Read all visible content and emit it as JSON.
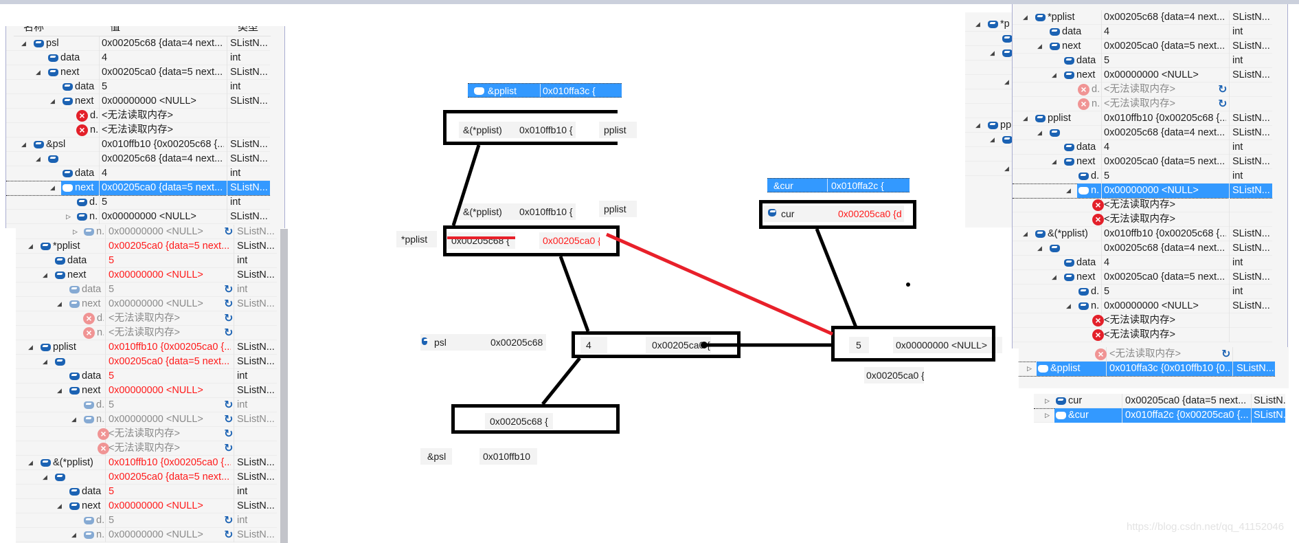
{
  "colors": {
    "selection": "#3399ff",
    "changed_value": "#ff1a1a",
    "icon_blue": "#1b62b3",
    "error_red": "#e3202a",
    "pointer_line_new": "#e8202a"
  },
  "panels": {
    "watch_top_left": {
      "header": {
        "name": "名称",
        "value": "值",
        "type": "类型"
      },
      "rows": [
        {
          "level": 0,
          "expander": "expanded",
          "icon": "field-icon",
          "name": "psl",
          "value": "0x00205c68 {data=4 next...",
          "type": "SListN...",
          "state": "normal"
        },
        {
          "level": 1,
          "expander": "none",
          "icon": "field-icon",
          "name": "data",
          "value": "4",
          "type": "int",
          "state": "normal"
        },
        {
          "level": 1,
          "expander": "expanded",
          "icon": "field-icon",
          "name": "next",
          "value": "0x00205ca0 {data=5 next...",
          "type": "SListN...",
          "state": "normal"
        },
        {
          "level": 2,
          "expander": "none",
          "icon": "field-icon",
          "name": "data",
          "value": "5",
          "type": "int",
          "state": "normal"
        },
        {
          "level": 2,
          "expander": "expanded",
          "icon": "field-icon",
          "name": "next",
          "value": "0x00000000 <NULL>",
          "type": "SListN...",
          "state": "normal"
        },
        {
          "level": 3,
          "expander": "none",
          "icon": "error-icon",
          "name": "d..",
          "value": "<无法读取内存>",
          "type": "",
          "state": "normal"
        },
        {
          "level": 3,
          "expander": "none",
          "icon": "error-icon",
          "name": "n..",
          "value": "<无法读取内存>",
          "type": "",
          "state": "normal"
        },
        {
          "level": 0,
          "expander": "expanded",
          "icon": "field-icon",
          "name": "&psl",
          "value": "0x010ffb10 {0x00205c68 {...",
          "type": "SListN...",
          "state": "normal"
        },
        {
          "level": 1,
          "expander": "expanded",
          "icon": "field-icon",
          "name": "",
          "value": "0x00205c68 {data=4 next...",
          "type": "SListN...",
          "state": "normal"
        },
        {
          "level": 2,
          "expander": "none",
          "icon": "field-icon",
          "name": "data",
          "value": "4",
          "type": "int",
          "state": "normal"
        },
        {
          "level": 2,
          "expander": "expanded",
          "icon": "field-icon",
          "name": "next",
          "value": "0x00205ca0 {data=5 next...",
          "type": "SListN...",
          "state": "selected"
        },
        {
          "level": 3,
          "expander": "none",
          "icon": "field-icon",
          "name": "d..",
          "value": "5",
          "type": "int",
          "state": "normal"
        },
        {
          "level": 3,
          "expander": "collapsed",
          "icon": "field-icon",
          "name": "n..",
          "value": "0x00000000 <NULL>",
          "type": "SListN...",
          "state": "normal"
        }
      ]
    },
    "watch_bottom_left": {
      "rows": [
        {
          "level": 3,
          "expander": "collapsed",
          "icon": "field-icon",
          "name": "n..",
          "value": "0x00000000 <NULL>",
          "type": "SListN...",
          "state": "stale",
          "refresh": true
        },
        {
          "level": 0,
          "expander": "expanded",
          "icon": "field-icon",
          "name": "*pplist",
          "value": "0x00205ca0 {data=5 next...",
          "type": "SListN...",
          "state": "changed"
        },
        {
          "level": 1,
          "expander": "none",
          "icon": "field-icon",
          "name": "data",
          "value": "5",
          "type": "int",
          "state": "changed"
        },
        {
          "level": 1,
          "expander": "expanded",
          "icon": "field-icon",
          "name": "next",
          "value": "0x00000000 <NULL>",
          "type": "SListN...",
          "state": "changed"
        },
        {
          "level": 2,
          "expander": "none",
          "icon": "field-icon",
          "name": "data",
          "value": "5",
          "type": "int",
          "state": "stale",
          "refresh": true
        },
        {
          "level": 2,
          "expander": "expanded",
          "icon": "field-icon",
          "name": "next",
          "value": "0x00000000 <NULL>",
          "type": "SListN...",
          "state": "stale",
          "refresh": true
        },
        {
          "level": 3,
          "expander": "none",
          "icon": "error-icon",
          "name": "d..",
          "value": "<无法读取内存>",
          "type": "",
          "state": "stale",
          "refresh": true
        },
        {
          "level": 3,
          "expander": "none",
          "icon": "error-icon",
          "name": "n..",
          "value": "<无法读取内存>",
          "type": "",
          "state": "stale",
          "refresh": true
        },
        {
          "level": 0,
          "expander": "expanded",
          "icon": "field-icon",
          "name": "pplist",
          "value": "0x010ffb10 {0x00205ca0 {...",
          "type": "SListN...",
          "state": "changed"
        },
        {
          "level": 1,
          "expander": "expanded",
          "icon": "field-icon",
          "name": "",
          "value": "0x00205ca0 {data=5 next...",
          "type": "SListN...",
          "state": "changed"
        },
        {
          "level": 2,
          "expander": "none",
          "icon": "field-icon",
          "name": "data",
          "value": "5",
          "type": "int",
          "state": "changed"
        },
        {
          "level": 2,
          "expander": "expanded",
          "icon": "field-icon",
          "name": "next",
          "value": "0x00000000 <NULL>",
          "type": "SListN...",
          "state": "changed"
        },
        {
          "level": 3,
          "expander": "none",
          "icon": "field-icon",
          "name": "d..",
          "value": "5",
          "type": "int",
          "state": "stale",
          "refresh": true
        },
        {
          "level": 3,
          "expander": "expanded",
          "icon": "field-icon",
          "name": "n..",
          "value": "0x00000000 <NULL>",
          "type": "SListN...",
          "state": "stale",
          "refresh": true
        },
        {
          "level": 4,
          "expander": "none",
          "icon": "error-icon",
          "name": "",
          "value": "<无法读取内存>",
          "type": "",
          "state": "stale",
          "refresh": true
        },
        {
          "level": 4,
          "expander": "none",
          "icon": "error-icon",
          "name": "",
          "value": "<无法读取内存>",
          "type": "",
          "state": "stale",
          "refresh": true
        },
        {
          "level": 0,
          "expander": "expanded",
          "icon": "field-icon",
          "name": "&(*pplist)",
          "value": "0x010ffb10 {0x00205ca0 {...",
          "type": "SListN...",
          "state": "changed"
        },
        {
          "level": 1,
          "expander": "expanded",
          "icon": "field-icon",
          "name": "",
          "value": "0x00205ca0 {data=5 next...",
          "type": "SListN...",
          "state": "changed"
        },
        {
          "level": 2,
          "expander": "none",
          "icon": "field-icon",
          "name": "data",
          "value": "5",
          "type": "int",
          "state": "changed"
        },
        {
          "level": 2,
          "expander": "expanded",
          "icon": "field-icon",
          "name": "next",
          "value": "0x00000000 <NULL>",
          "type": "SListN...",
          "state": "changed"
        },
        {
          "level": 3,
          "expander": "none",
          "icon": "field-icon",
          "name": "d..",
          "value": "5",
          "type": "int",
          "state": "stale",
          "refresh": true
        },
        {
          "level": 3,
          "expander": "expanded",
          "icon": "field-icon",
          "name": "n..",
          "value": "0x00000000 <NULL>",
          "type": "SListN...",
          "state": "stale",
          "refresh": true
        }
      ]
    },
    "watch_behind_right": {
      "rows": [
        {
          "level": 0,
          "expander": "expanded",
          "icon": "field-icon",
          "name": "*p",
          "value": "",
          "type": "",
          "state": "normal"
        },
        {
          "level": 1,
          "expander": "none",
          "icon": "field-icon",
          "name": "",
          "value": "",
          "type": "",
          "state": "normal"
        },
        {
          "level": 1,
          "expander": "expanded",
          "icon": "field-icon",
          "name": "",
          "value": "",
          "type": "",
          "state": "normal"
        },
        {
          "level": 0,
          "expander": "none",
          "icon": "none",
          "name": "",
          "value": "",
          "type": "",
          "state": "normal"
        },
        {
          "level": 2,
          "expander": "expanded",
          "icon": "none",
          "name": "",
          "value": "",
          "type": "",
          "state": "normal"
        },
        {
          "level": 0,
          "expander": "none",
          "icon": "none",
          "name": "",
          "value": "",
          "type": "",
          "state": "normal"
        },
        {
          "level": 0,
          "expander": "none",
          "icon": "none",
          "name": "",
          "value": "",
          "type": "",
          "state": "normal"
        },
        {
          "level": 0,
          "expander": "expanded",
          "icon": "field-icon",
          "name": "pp",
          "value": "",
          "type": "",
          "state": "normal"
        },
        {
          "level": 1,
          "expander": "expanded",
          "icon": "field-icon",
          "name": "",
          "value": "",
          "type": "",
          "state": "normal"
        },
        {
          "level": 0,
          "expander": "none",
          "icon": "none",
          "name": "",
          "value": "",
          "type": "",
          "state": "normal"
        },
        {
          "level": 2,
          "expander": "expanded",
          "icon": "none",
          "name": "",
          "value": "",
          "type": "",
          "state": "normal"
        }
      ]
    },
    "watch_top_right": {
      "rows": [
        {
          "level": 0,
          "expander": "expanded",
          "icon": "field-icon",
          "name": "*pplist",
          "value": "0x00205c68 {data=4 next...",
          "type": "SListN...",
          "state": "normal"
        },
        {
          "level": 1,
          "expander": "none",
          "icon": "field-icon",
          "name": "data",
          "value": "4",
          "type": "int",
          "state": "normal"
        },
        {
          "level": 1,
          "expander": "expanded",
          "icon": "field-icon",
          "name": "next",
          "value": "0x00205ca0 {data=5 next...",
          "type": "SListN...",
          "state": "normal"
        },
        {
          "level": 2,
          "expander": "none",
          "icon": "field-icon",
          "name": "data",
          "value": "5",
          "type": "int",
          "state": "normal"
        },
        {
          "level": 2,
          "expander": "expanded",
          "icon": "field-icon",
          "name": "next",
          "value": "0x00000000 <NULL>",
          "type": "SListN...",
          "state": "normal"
        },
        {
          "level": 3,
          "expander": "none",
          "icon": "error-icon",
          "name": "d..",
          "value": "<无法读取内存>",
          "type": "",
          "state": "stale",
          "refresh": true
        },
        {
          "level": 3,
          "expander": "none",
          "icon": "error-icon",
          "name": "n..",
          "value": "<无法读取内存>",
          "type": "",
          "state": "stale",
          "refresh": true
        },
        {
          "level": 0,
          "expander": "expanded",
          "icon": "field-icon",
          "name": "pplist",
          "value": "0x010ffb10 {0x00205c68 {...",
          "type": "SListN...",
          "state": "normal"
        },
        {
          "level": 1,
          "expander": "expanded",
          "icon": "field-icon",
          "name": "",
          "value": "0x00205c68 {data=4 next...",
          "type": "SListN...",
          "state": "normal"
        },
        {
          "level": 2,
          "expander": "none",
          "icon": "field-icon",
          "name": "data",
          "value": "4",
          "type": "int",
          "state": "normal"
        },
        {
          "level": 2,
          "expander": "expanded",
          "icon": "field-icon",
          "name": "next",
          "value": "0x00205ca0 {data=5 next...",
          "type": "SListN...",
          "state": "normal"
        },
        {
          "level": 3,
          "expander": "none",
          "icon": "field-icon",
          "name": "d..",
          "value": "5",
          "type": "int",
          "state": "normal"
        },
        {
          "level": 3,
          "expander": "expanded",
          "icon": "field-icon",
          "name": "n..",
          "value": "0x00000000 <NULL>",
          "type": "SListN...",
          "state": "selected"
        },
        {
          "level": 4,
          "expander": "none",
          "icon": "error-icon",
          "name": "",
          "value": "<无法读取内存>",
          "type": "",
          "state": "normal"
        },
        {
          "level": 4,
          "expander": "none",
          "icon": "error-icon",
          "name": "",
          "value": "<无法读取内存>",
          "type": "",
          "state": "normal"
        },
        {
          "level": 0,
          "expander": "expanded",
          "icon": "field-icon",
          "name": "&(*pplist)",
          "value": "0x010ffb10 {0x00205c68 {...",
          "type": "SListN...",
          "state": "normal"
        },
        {
          "level": 1,
          "expander": "expanded",
          "icon": "field-icon",
          "name": "",
          "value": "0x00205c68 {data=4 next...",
          "type": "SListN...",
          "state": "normal"
        },
        {
          "level": 2,
          "expander": "none",
          "icon": "field-icon",
          "name": "data",
          "value": "4",
          "type": "int",
          "state": "normal"
        },
        {
          "level": 2,
          "expander": "expanded",
          "icon": "field-icon",
          "name": "next",
          "value": "0x00205ca0 {data=5 next...",
          "type": "SListN...",
          "state": "normal"
        },
        {
          "level": 3,
          "expander": "none",
          "icon": "field-icon",
          "name": "d..",
          "value": "5",
          "type": "int",
          "state": "normal"
        },
        {
          "level": 3,
          "expander": "expanded",
          "icon": "field-icon",
          "name": "n..",
          "value": "0x00000000 <NULL>",
          "type": "SListN...",
          "state": "normal"
        },
        {
          "level": 4,
          "expander": "none",
          "icon": "error-icon",
          "name": "",
          "value": "<无法读取内存>",
          "type": "",
          "state": "normal"
        },
        {
          "level": 4,
          "expander": "none",
          "icon": "error-icon",
          "name": "",
          "value": "<无法读取内存>",
          "type": "",
          "state": "normal"
        }
      ]
    },
    "watch_pplist": {
      "rows": [
        {
          "level": 4,
          "expander": "none",
          "icon": "error-icon",
          "name": "",
          "value": "<无法读取内存>",
          "type": "",
          "state": "stale",
          "refresh": true
        },
        {
          "level": 0,
          "expander": "collapsed",
          "icon": "field-icon",
          "name": "&pplist",
          "value": "0x010ffa3c {0x010ffb10 {0...",
          "type": "SListN...",
          "state": "selected"
        }
      ]
    },
    "watch_cur": {
      "rows": [
        {
          "level": 0,
          "expander": "collapsed",
          "icon": "field-icon",
          "name": "cur",
          "value": "0x00205ca0 {data=5 next...",
          "type": "SListN...",
          "state": "normal"
        },
        {
          "level": 0,
          "expander": "collapsed",
          "icon": "field-icon",
          "name": "&cur",
          "value": "0x010ffa2c {0x00205ca0 {...",
          "type": "SListN...",
          "state": "selected"
        }
      ]
    }
  },
  "diagram": {
    "pplist_addr_bar": {
      "name": "&pplist",
      "value": "0x010ffa3c {"
    },
    "box_pplist": {
      "name": "&(*pplist)",
      "value": "0x010ffb10 {",
      "label": "pplist"
    },
    "row_pplist_2": {
      "name": "&(*pplist)",
      "value": "0x010ffb10 {",
      "label": "pplist"
    },
    "box_star_pplist": {
      "label": "*pplist",
      "old_value": "0x00205c68 {",
      "new_value": "0x00205ca0 {"
    },
    "psl_row": {
      "name": "psl",
      "value": "0x00205c68"
    },
    "node1": {
      "data": "4",
      "next": "0x00205ca0 {"
    },
    "box_psl": {
      "value": "0x00205c68 {"
    },
    "amp_psl": {
      "name": "&psl",
      "value": "0x010ffb10"
    },
    "cur_addr_bar": {
      "name": "&cur",
      "value": "0x010ffa2c {"
    },
    "box_cur": {
      "name": "cur",
      "value": "0x00205ca0 {d"
    },
    "node2": {
      "data": "5",
      "next": "0x00000000 <NULL>",
      "address": "0x00205ca0 {"
    }
  },
  "watermark": "https://blog.csdn.net/qq_41152046"
}
